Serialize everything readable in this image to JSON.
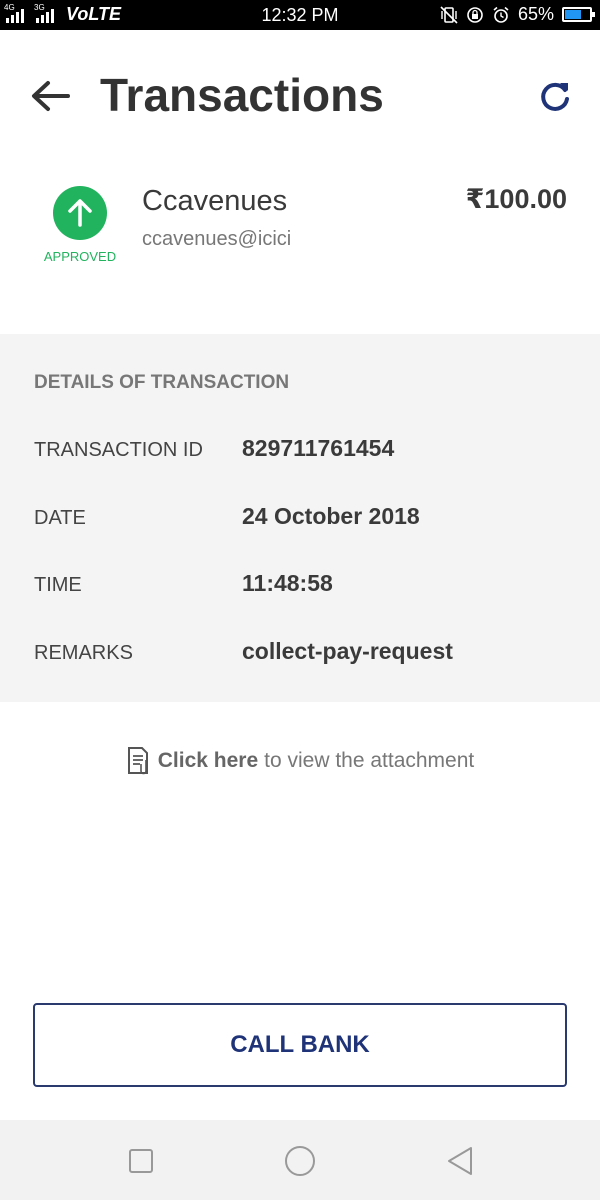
{
  "status_bar": {
    "network_1": "4G",
    "network_2": "3G",
    "volte": "VoLTE",
    "time": "12:32 PM",
    "battery_percent": "65%",
    "battery_level": 0.65,
    "icons": [
      "vibrate-icon",
      "rotation-lock-icon",
      "alarm-icon",
      "battery-icon"
    ]
  },
  "header": {
    "title": "Transactions",
    "back_icon": "arrow-left-icon",
    "refresh_icon": "refresh-icon"
  },
  "transaction": {
    "status": "APPROVED",
    "status_icon": "arrow-up-icon",
    "status_color": "#22b35e",
    "merchant_name": "Ccavenues",
    "merchant_vpa": "ccavenues@icici",
    "amount": "₹100.00"
  },
  "details": {
    "heading": "DETAILS OF TRANSACTION",
    "rows": [
      {
        "label": "TRANSACTION ID",
        "value": "829711761454"
      },
      {
        "label": "DATE",
        "value": "24 October 2018"
      },
      {
        "label": "TIME",
        "value": "11:48:58"
      },
      {
        "label": "REMARKS",
        "value": "collect-pay-request"
      }
    ]
  },
  "attachment": {
    "link_text": "Click here",
    "rest_text": "to view the attachment",
    "icon": "document-attachment-icon"
  },
  "actions": {
    "call_bank_label": "CALL BANK",
    "accent_color": "#1f3378"
  },
  "nav": {
    "icons": [
      "recent-apps-icon",
      "home-icon",
      "back-icon"
    ]
  }
}
